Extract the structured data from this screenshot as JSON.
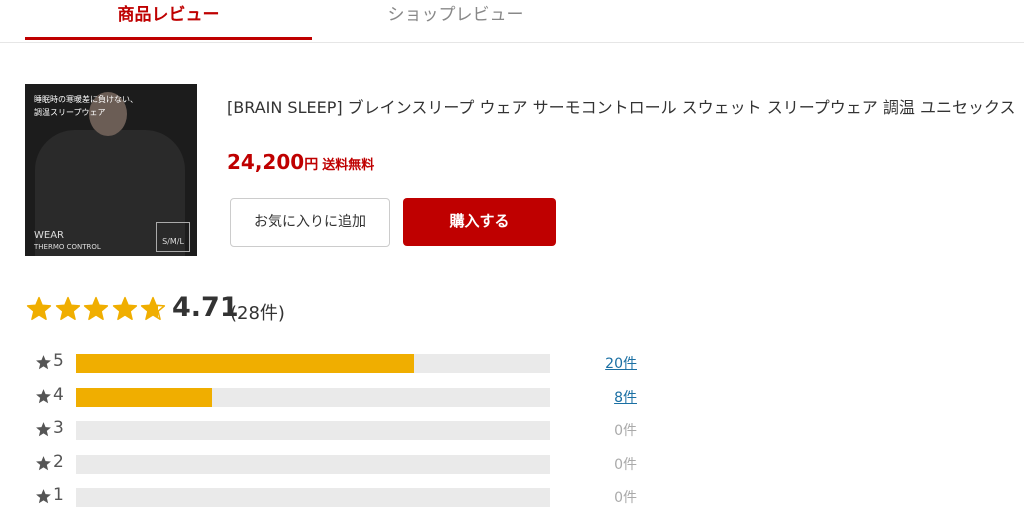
{
  "tabs": [
    {
      "label": "商品レビュー",
      "active": true
    },
    {
      "label": "ショップレビュー",
      "active": false
    }
  ],
  "product": {
    "image_caption_line1": "睡眠時の寒暖差に負けない、",
    "image_caption_line2": "調温スリープウェア",
    "image_brand_line1": "WEAR",
    "image_brand_line2": "THERMO CONTROL",
    "image_size_label": "S/M/L",
    "title": "[BRAIN SLEEP] ブレインスリープ ウェア サーモコントロール スウェット スリープウェア 調温 ユニセックス",
    "price_number": "24,200",
    "price_unit": "円",
    "shipping": "送料無料",
    "favorite_label": "お気に入りに追加",
    "buy_label": "購入する"
  },
  "rating": {
    "average": "4.71",
    "average_value": 4.71,
    "count_label": "(28件)",
    "star_color": "#f0ae00",
    "bar_color": "#f0ae00",
    "breakdown": [
      {
        "star": "5",
        "count_label": "20件",
        "count": 20,
        "fraction": 0.714
      },
      {
        "star": "4",
        "count_label": "8件",
        "count": 8,
        "fraction": 0.286
      },
      {
        "star": "3",
        "count_label": "0件",
        "count": 0,
        "fraction": 0
      },
      {
        "star": "2",
        "count_label": "0件",
        "count": 0,
        "fraction": 0
      },
      {
        "star": "1",
        "count_label": "0件",
        "count": 0,
        "fraction": 0
      }
    ]
  },
  "colors": {
    "accent": "#bf0000",
    "link": "#1a6fa3"
  }
}
